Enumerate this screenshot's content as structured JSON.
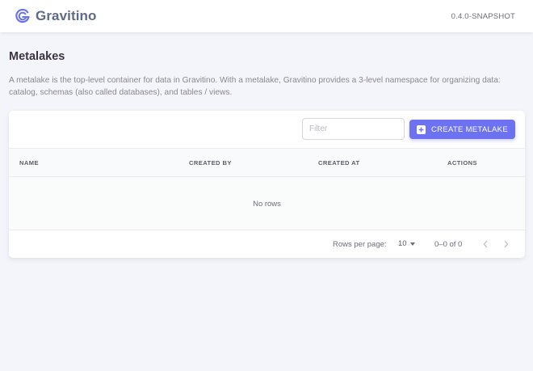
{
  "header": {
    "brand": "Gravitino",
    "version": "0.4.0-SNAPSHOT",
    "logo_icon": "gravitino-logo-icon",
    "logo_color": "#6b72f0"
  },
  "page": {
    "title": "Metalakes",
    "description": "A metalake is the top-level container for data in Gravitino. With a metalake, Gravitino provides a 3-level namespace for organizing data: catalog, schemas (also called databases), and tables / views."
  },
  "toolbar": {
    "filter_placeholder": "Filter",
    "filter_value": "",
    "create_label": "CREATE METALAKE",
    "create_icon": "plus-square-icon",
    "accent": "#6d72f3"
  },
  "table": {
    "columns": [
      "NAME",
      "CREATED BY",
      "CREATED AT",
      "ACTIONS"
    ],
    "rows": [],
    "empty_text": "No rows"
  },
  "pagination": {
    "rows_per_page_label": "Rows per page:",
    "rows_per_page": "10",
    "range": "0–0 of 0",
    "prev_icon": "chevron-left-icon",
    "next_icon": "chevron-right-icon"
  }
}
